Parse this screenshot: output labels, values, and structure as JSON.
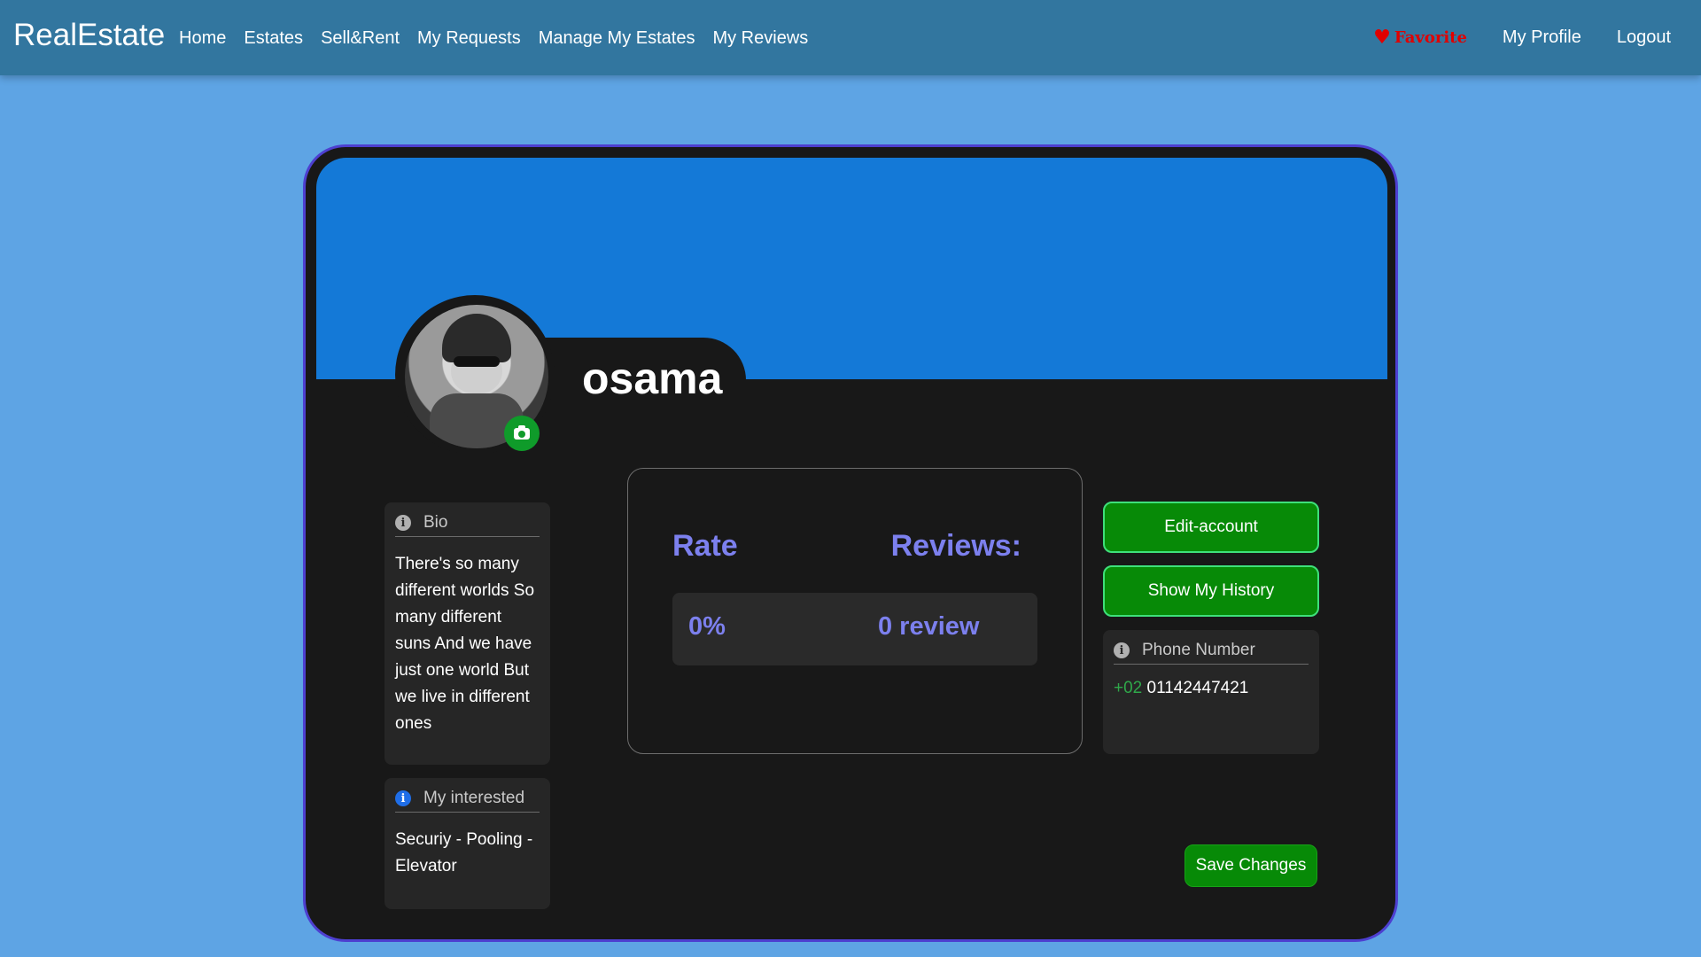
{
  "navbar": {
    "brand": "RealEstate",
    "links": [
      "Home",
      "Estates",
      "Sell&Rent",
      "My Requests",
      "Manage My Estates",
      "My Reviews"
    ],
    "favorite": "Favorite",
    "profile": "My Profile",
    "logout": "Logout"
  },
  "profile": {
    "username": "osama",
    "bio_title": "Bio",
    "bio_text": "There's so many different worlds So many different suns And we have just one world But we live in different ones",
    "interest_title": "My interested",
    "interest_text": "Securiy - Pooling - Elevator"
  },
  "stats": {
    "rate_label": "Rate",
    "reviews_label": "Reviews:",
    "rate_value": "0%",
    "review_value": "0 review"
  },
  "actions": {
    "edit": "Edit-account",
    "history": "Show My History",
    "save": "Save Changes"
  },
  "phone": {
    "title": "Phone Number",
    "prefix": "+02",
    "number": "01142447421"
  },
  "colors": {
    "page_bg": "#5ea4e4",
    "navbar": "#32769f",
    "cover": "#1479d7",
    "card_bg": "#181818",
    "accent_purple": "#7c80ee",
    "button_green": "#078a07",
    "favorite_red": "#e00000"
  }
}
